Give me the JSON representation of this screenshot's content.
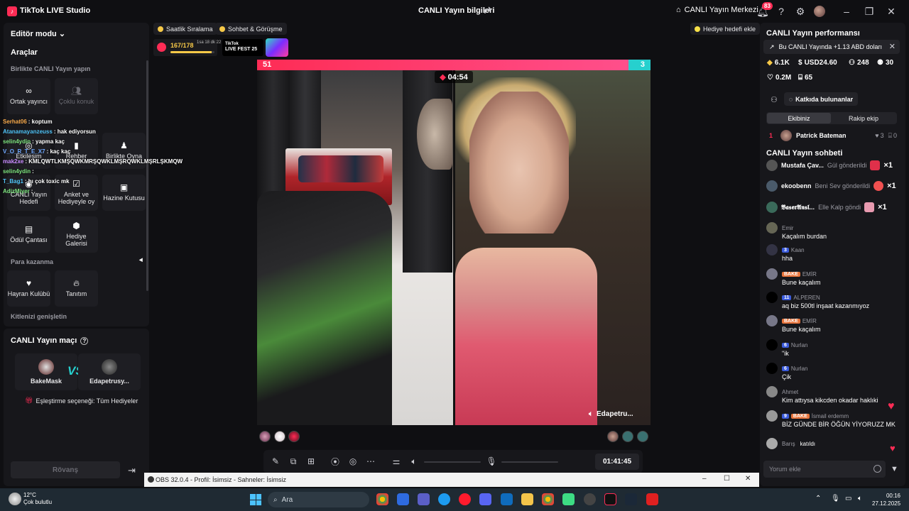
{
  "titlebar": {
    "app_name": "TikTok LIVE Studio",
    "center_title": "CANLI Yayın bilgileri",
    "live_center": "CANLI Yayın Merkezi",
    "notifications": "83"
  },
  "left": {
    "editor_mode": "Editör modu",
    "tools_title": "Araçlar",
    "collab_title": "Birlikte CANLI Yayın yapın",
    "collab_items": [
      "Ortak yayıncı",
      "Çoklu konuk"
    ],
    "tool_row2": [
      "Etkileşim",
      "Rehber",
      "Birlikte Oyna"
    ],
    "tool_row3": [
      "CANLI Yayın Hedefi",
      "Anket ve Hediyeyle oy",
      "Hazine Kutusu"
    ],
    "tool_row4": [
      "Ödül Çantası",
      "Hediye Galerisi"
    ],
    "monetize_title": "Para kazanma",
    "monetize_items": [
      "Hayran Kulübü",
      "Tanıtım"
    ],
    "expand_title": "Kitlenizi genişletin"
  },
  "overlay_chat": [
    {
      "user": "Serhat06",
      "msg": ": koptum"
    },
    {
      "user": "Atanamayanzeuss",
      "msg": ": hak ediyorsun"
    },
    {
      "user": "selin4ydin",
      "msg": ": yapma kaç"
    },
    {
      "user": "V_O_R_T_E_X7",
      "msg": ": kaç kaç"
    },
    {
      "user": "mak2xe",
      "msg": ": KMLQWTLKMŞQWKMRŞQWKLMŞRQWKLMŞRLŞKMQW"
    },
    {
      "user": "selin4ydin",
      "msg": ":"
    },
    {
      "user": "T_Bag1",
      "msg": ": hı çok toxic mk"
    },
    {
      "user": "AdizMiyer",
      "msg": ":"
    }
  ],
  "match": {
    "title": "CANLI Yayın maçı",
    "player_left": "BakeMask",
    "player_right": "Edapetrusy...",
    "vs": "VS",
    "pairing": "Eşleştirme seçeneği: Tüm Hediyeler",
    "rematch": "Rövanş"
  },
  "center": {
    "chip1": "Saatlik Sıralama",
    "chip2": "Sohbet & Görüşme",
    "goal_chip": "Hediye hedefi ekle",
    "stats_value": "167/178",
    "stats_timer": "1sa 18 dk 22 sn",
    "stats_progress": 0.94,
    "fest_line1": "TikTok",
    "fest_line2": "LIVE FEST 25",
    "score_left": "51",
    "score_right": "3",
    "battle_timer": "04:54",
    "opponent_name": "Edapetru...",
    "stream_time": "01:41:45"
  },
  "right": {
    "perf_title": "CANLI Yayın performansı",
    "perf_banner": "Bu CANLI Yayında +1.13 ABD doları",
    "metrics": {
      "coins": "6.1K",
      "usd": "USD24.60",
      "viewers": "248",
      "joined": "30",
      "likes": "0.2M",
      "gifts": "65"
    },
    "contributors_btn": "Katkıda bulunanlar",
    "tab_team": "Ekibiniz",
    "tab_rival": "Rakip ekip",
    "rank_row": {
      "rank": "1",
      "name": "Patrick Bateman",
      "hearts": "3",
      "zero": "0"
    },
    "chat_title": "CANLI Yayın sohbeti",
    "gifts": [
      {
        "name": "Mustafa Çav...",
        "text": "Gül gönderildi",
        "count": "×1"
      },
      {
        "name": "ekoobenn",
        "text": "Beni Sev gönderildi",
        "count": "×1"
      },
      {
        "name": "𝕭𝖆𝖘𝖊𝖗𝕬𝖓𝖘𝖑...",
        "text": "Elle Kalp göndi",
        "count": "×1"
      }
    ],
    "messages": [
      {
        "user": "Emir",
        "badge": "",
        "body": "Kaçalım burdan"
      },
      {
        "user": "Kaan",
        "badge": "3",
        "body": "hha"
      },
      {
        "user": "EMİR",
        "badge": "BAKE",
        "body": "Bune kaçalım"
      },
      {
        "user": "ALPEREN",
        "badge": "11",
        "body": "aq biz 500tl inşaat kazanmıyoz"
      },
      {
        "user": "EMİR",
        "badge": "BAKE",
        "body": "Bune kaçalım"
      },
      {
        "user": "Nurlan",
        "badge": "6",
        "body": "\"ik"
      },
      {
        "user": "Nurlan",
        "badge": "6",
        "body": "Çik"
      },
      {
        "user": "Ahmet",
        "badge": "",
        "body": "Kim attıysa kikcden okadar haklıki"
      },
      {
        "user": "İsmail erdemm",
        "badge": "9",
        "body": "BİZ GÜNDE BİR ÖĞÜN YİYORUZZ MK"
      },
      {
        "user": "Barış",
        "badge": "",
        "body": "katıldı"
      }
    ],
    "comment_placeholder": "Yorum ekle"
  },
  "obs": {
    "title": "OBS 32.0.4 - Profil: İsimsiz - Sahneler: İsimsiz"
  },
  "taskbar": {
    "temp": "12°C",
    "weather": "Çok bulutlu",
    "search": "Ara",
    "time": "00:16",
    "date": "27.12.2025"
  }
}
